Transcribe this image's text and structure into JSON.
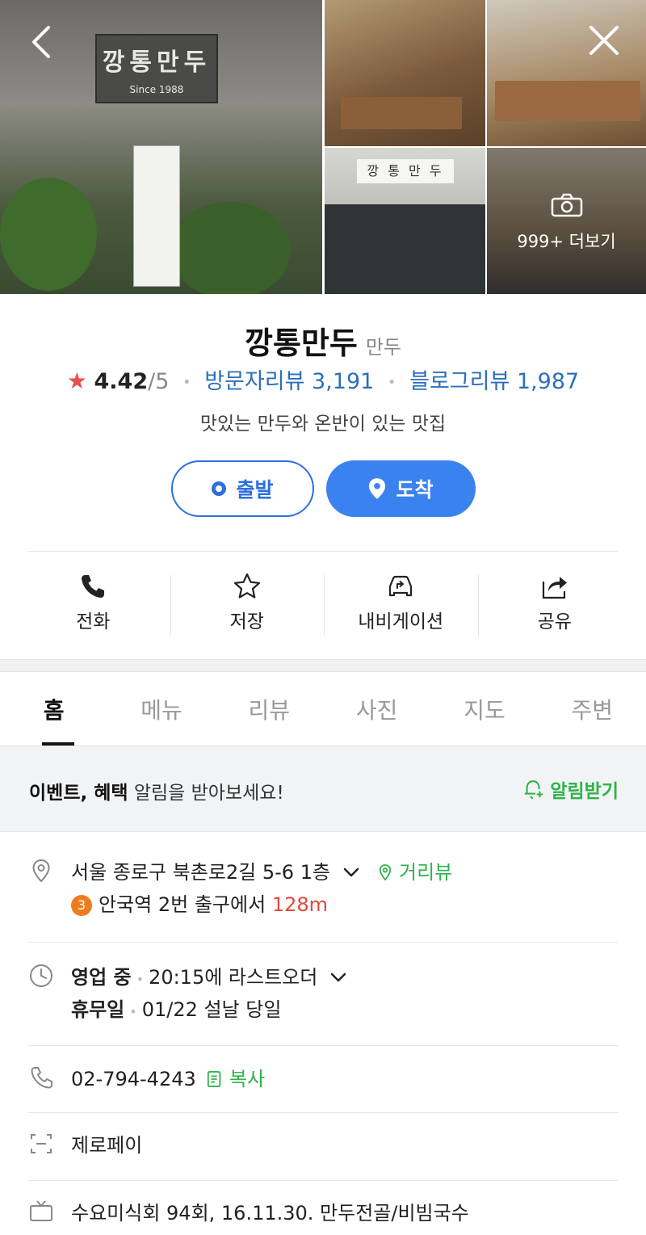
{
  "gallery": {
    "main_sign_text": "깡통만두",
    "main_sign_sub": "Since 1988",
    "shop_sign_text": "깡 통 만 두",
    "more_label": "999+ 더보기"
  },
  "place": {
    "name": "깡통만두",
    "category": "만두",
    "rating": "4.42",
    "rating_max": "/5",
    "visitor_reviews": "방문자리뷰 3,191",
    "blog_reviews": "블로그리뷰 1,987",
    "description": "맛있는 만두와 온반이 있는 맛집"
  },
  "route": {
    "depart_label": "출발",
    "arrive_label": "도착"
  },
  "actions": [
    {
      "label": "전화",
      "icon": "phone-icon"
    },
    {
      "label": "저장",
      "icon": "star-icon"
    },
    {
      "label": "내비게이션",
      "icon": "car-navigation-icon"
    },
    {
      "label": "공유",
      "icon": "share-icon"
    }
  ],
  "tabs": [
    "홈",
    "메뉴",
    "리뷰",
    "사진",
    "지도",
    "주변"
  ],
  "active_tab": "홈",
  "notice": {
    "bold": "이벤트, 혜택",
    "text": " 알림을 받아보세요!",
    "action": "알림받기"
  },
  "info": {
    "address": "서울 종로구 북촌로2길 5-6 1층",
    "street_view": "거리뷰",
    "subway_line": "3",
    "subway_text": "안국역 2번 출구에서",
    "subway_distance": "128m",
    "hours_status": "영업 중",
    "hours_detail": "20:15에 라스트오더",
    "holiday_label": "휴무일",
    "holiday_detail": "01/22 설날 당일",
    "phone": "02-794-4243",
    "copy_label": "복사",
    "zeropay": "제로페이",
    "tv": "수요미식회 94회, 16.11.30. 만두전골/비빔국수"
  },
  "colors": {
    "primary_blue": "#3a82ef",
    "green": "#2eb34a",
    "review_blue": "#2c6fb8",
    "star_red": "#e84f4f",
    "subway_orange": "#ef7c1c"
  }
}
